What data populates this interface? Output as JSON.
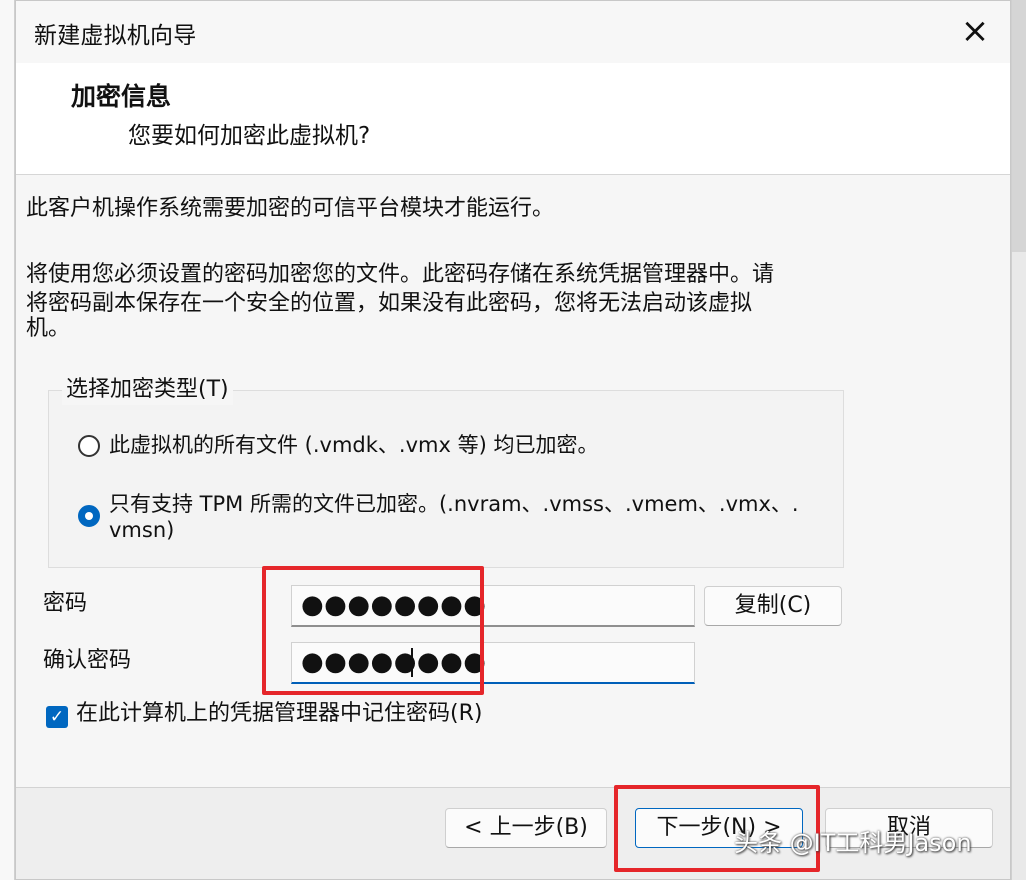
{
  "window": {
    "title": "新建虚拟机向导",
    "close_label": "×"
  },
  "header": {
    "title": "加密信息",
    "subtitle": "您要如何加密此虚拟机?"
  },
  "content": {
    "intro": "此客户机操作系统需要加密的可信平台模块才能运行。",
    "description_line_1": "将使用您必须设置的密码加密您的文件。此密码存储在系统凭据管理器中。请",
    "description_line_2": "将密码副本保存在一个安全的位置，如果没有此密码，您将无法启动该虚拟",
    "description_line_3": "机。"
  },
  "encryption_type": {
    "legend": "选择加密类型(T)",
    "options": [
      {
        "label": "此虚拟机的所有文件 (.vmdk、.vmx 等) 均已加密。",
        "selected": false
      },
      {
        "label_line_1": "只有支持 TPM 所需的文件已加密。(.nvram、.vmss、.vmem、.vmx、.",
        "label_line_2": "vmsn)",
        "selected": true
      }
    ]
  },
  "password": {
    "label": "密码",
    "value": "●●●●●●●●",
    "copy_button": "复制(C)"
  },
  "confirm_password": {
    "label": "确认密码",
    "value": "●●●●●●●●"
  },
  "remember_password": {
    "checked": true,
    "label": "在此计算机上的凭据管理器中记住密码(R)"
  },
  "footer": {
    "back_button": "< 上一步(B)",
    "next_button": "下一步(N) >",
    "cancel_button": "取消"
  },
  "watermark": {
    "text": "头条 @IT工科男Jason"
  },
  "colors": {
    "accent": "#0067c0",
    "highlight": "#e5262a",
    "dialog_background": "#f3f3f3"
  }
}
